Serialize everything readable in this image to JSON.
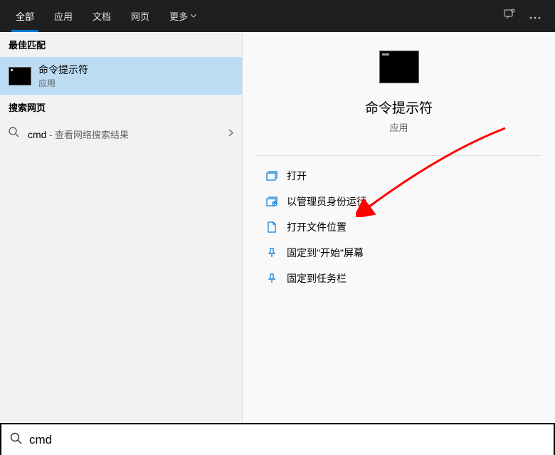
{
  "header": {
    "tabs": [
      "全部",
      "应用",
      "文档",
      "网页",
      "更多"
    ]
  },
  "leftPanel": {
    "bestMatch": "最佳匹配",
    "result": {
      "title": "命令提示符",
      "sub": "应用"
    },
    "webHeader": "搜索网页",
    "webQuery": "cmd",
    "webHint": " - 查看网络搜索结果"
  },
  "rightPanel": {
    "title": "命令提示符",
    "sub": "应用",
    "actions": [
      "打开",
      "以管理员身份运行",
      "打开文件位置",
      "固定到\"开始\"屏幕",
      "固定到任务栏"
    ]
  },
  "searchBar": {
    "value": "cmd"
  }
}
